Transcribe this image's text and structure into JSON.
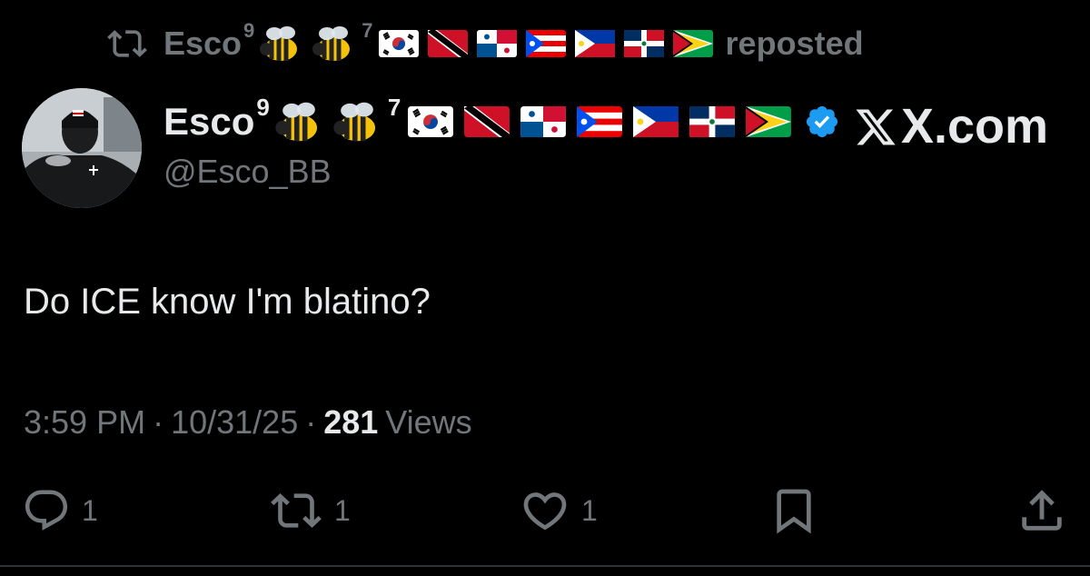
{
  "repost": {
    "icon": "repost-icon",
    "name": "Esco",
    "sup_left": "9",
    "sup_right": "7",
    "label": "reposted"
  },
  "author": {
    "name": "Esco",
    "sup_left": "9",
    "sup_right": "7",
    "handle": "@Esco_BB",
    "verified": true,
    "emojis": [
      "honeybee",
      "honeybee",
      "flag-south-korea",
      "flag-trinidad-and-tobago",
      "flag-panama",
      "flag-puerto-rico",
      "flag-philippines",
      "flag-dominican-republic",
      "flag-guyana"
    ]
  },
  "watermark": {
    "text": "X.com"
  },
  "tweet": {
    "text": "Do ICE know I'm blatino?",
    "time": "3:59 PM",
    "date": "10/31/25",
    "separator": "·",
    "views_count": "281",
    "views_label": "Views"
  },
  "actions": {
    "reply_count": "1",
    "repost_count": "1",
    "like_count": "1"
  },
  "colors": {
    "background": "#000000",
    "primary_text": "#e7e9ea",
    "secondary_text": "#71767b",
    "verified_blue": "#1d9bf0"
  }
}
